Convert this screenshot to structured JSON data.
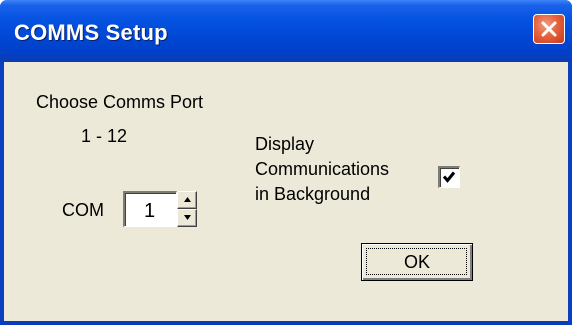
{
  "window": {
    "title": "COMMS Setup",
    "close_icon": "close-icon"
  },
  "port": {
    "heading": "Choose Comms Port",
    "range": "1 - 12",
    "prefix": "COM",
    "value": "1",
    "up_icon": "spin-up-arrow-icon",
    "down_icon": "spin-down-arrow-icon"
  },
  "display_option": {
    "label_lines": [
      "Display",
      "Communications",
      "in Background"
    ],
    "checked": true,
    "check_icon": "checkmark-icon"
  },
  "ok_label": "OK",
  "colors": {
    "titlebar": "#0047d4",
    "close_button": "#e6623c",
    "dialog_background": "#ece9d8"
  }
}
